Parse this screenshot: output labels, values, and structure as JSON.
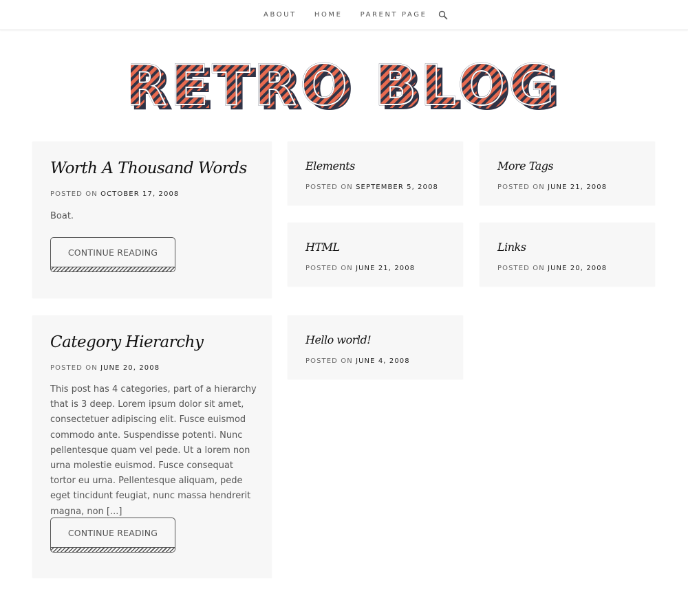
{
  "nav": {
    "items": [
      {
        "label": "ABOUT"
      },
      {
        "label": "HOME"
      },
      {
        "label": "PARENT PAGE"
      }
    ],
    "search_icon": "search-icon"
  },
  "logo": {
    "text": "RETRO BLOG",
    "colors": {
      "stripe": "#e86a4f",
      "dark": "#2f3346",
      "outline": "#2f3346"
    }
  },
  "posts": [
    {
      "title": "Worth A Thousand Words",
      "meta_prefix": "POSTED ON ",
      "date": "OCTOBER 17, 2008",
      "excerpt": "Boat.",
      "button": "CONTINUE READING"
    },
    {
      "title": "Elements",
      "meta_prefix": "POSTED ON ",
      "date": "SEPTEMBER 5, 2008"
    },
    {
      "title": "More Tags",
      "meta_prefix": "POSTED ON ",
      "date": "JUNE 21, 2008"
    },
    {
      "title": "HTML",
      "meta_prefix": "POSTED ON ",
      "date": "JUNE 21, 2008"
    },
    {
      "title": "Links",
      "meta_prefix": "POSTED ON ",
      "date": "JUNE 20, 2008"
    },
    {
      "title": "Category Hierarchy",
      "meta_prefix": "POSTED ON ",
      "date": "JUNE 20, 2008",
      "excerpt": "This post has 4 categories, part of a hierarchy that is 3 deep. Lorem ipsum dolor sit amet, consectetuer adipiscing elit. Fusce euismod commodo ante. Suspendisse potenti. Nunc pellentesque quam vel pede. Ut a lorem non urna molestie euismod. Fusce consequat tortor eu urna. Pellentesque aliquam, pede eget tincidunt feugiat, nunc massa hendrerit magna, non [...]",
      "button": "CONTINUE READING"
    },
    {
      "title": "Hello world!",
      "meta_prefix": "POSTED ON ",
      "date": "JUNE 4, 2008"
    }
  ]
}
